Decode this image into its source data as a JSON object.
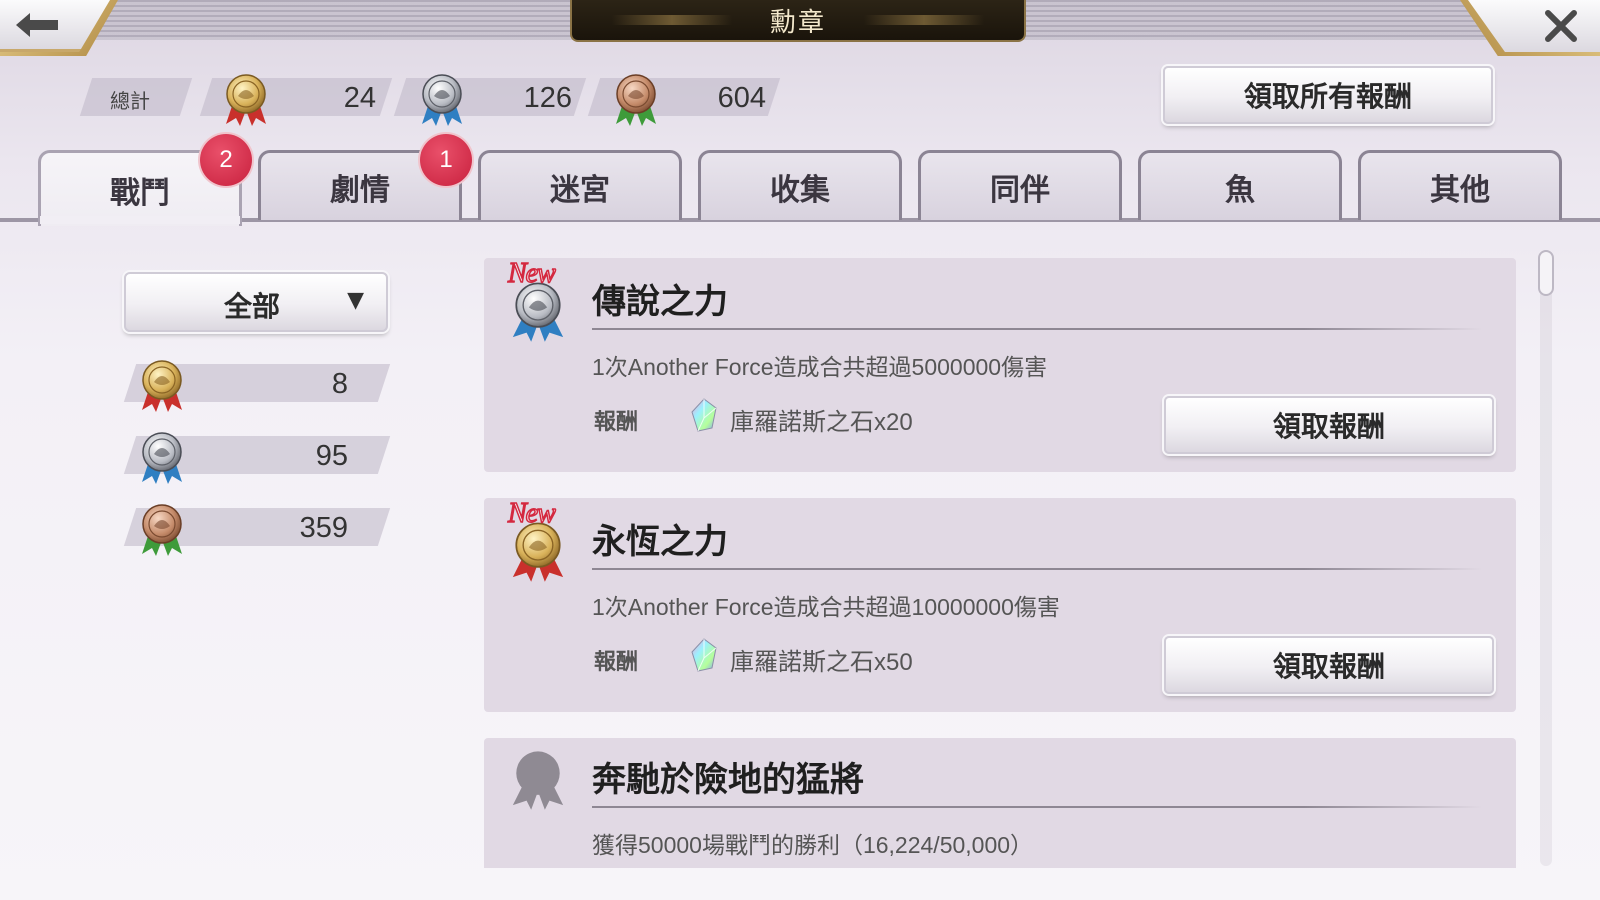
{
  "header": {
    "title": "勳章",
    "back_icon": "arrow-left-icon",
    "close_icon": "close-icon"
  },
  "totals": {
    "label": "總計",
    "gold": "24",
    "silver": "126",
    "bronze": "604",
    "claim_all_label": "領取所有報酬"
  },
  "tabs": [
    {
      "label": "戰鬥",
      "badge": "2",
      "active": true
    },
    {
      "label": "劇情",
      "badge": "1"
    },
    {
      "label": "迷宮"
    },
    {
      "label": "收集"
    },
    {
      "label": "同伴"
    },
    {
      "label": "魚"
    },
    {
      "label": "其他"
    }
  ],
  "sidebar": {
    "filter_label": "全部",
    "counts": {
      "gold": "8",
      "silver": "95",
      "bronze": "359"
    }
  },
  "achievements": [
    {
      "new_tag": "New",
      "medal": "silver-medal",
      "title": "傳說之力",
      "description": "1次Another Force造成合共超過5000000傷害",
      "reward_label": "報酬",
      "reward_icon": "crystal-icon",
      "reward": "庫羅諾斯之石x20",
      "claim_label": "領取報酬"
    },
    {
      "new_tag": "New",
      "medal": "gold-medal",
      "title": "永恆之力",
      "description": "1次Another Force造成合共超過10000000傷害",
      "reward_label": "報酬",
      "reward_icon": "crystal-icon",
      "reward": "庫羅諾斯之石x50",
      "claim_label": "領取報酬"
    },
    {
      "medal": "locked-medal",
      "title": "奔馳於險地的猛將",
      "description": "獲得50000場戰鬥的勝利（16,224/50,000）"
    }
  ],
  "colors": {
    "badge_red": "#d42a45",
    "tab_border": "#8b8494",
    "card_bg": "#e1d9e4",
    "gold_ribbon": "#c9302c",
    "silver_ribbon": "#2f7fc2",
    "bronze_ribbon": "#3e9b3a"
  }
}
